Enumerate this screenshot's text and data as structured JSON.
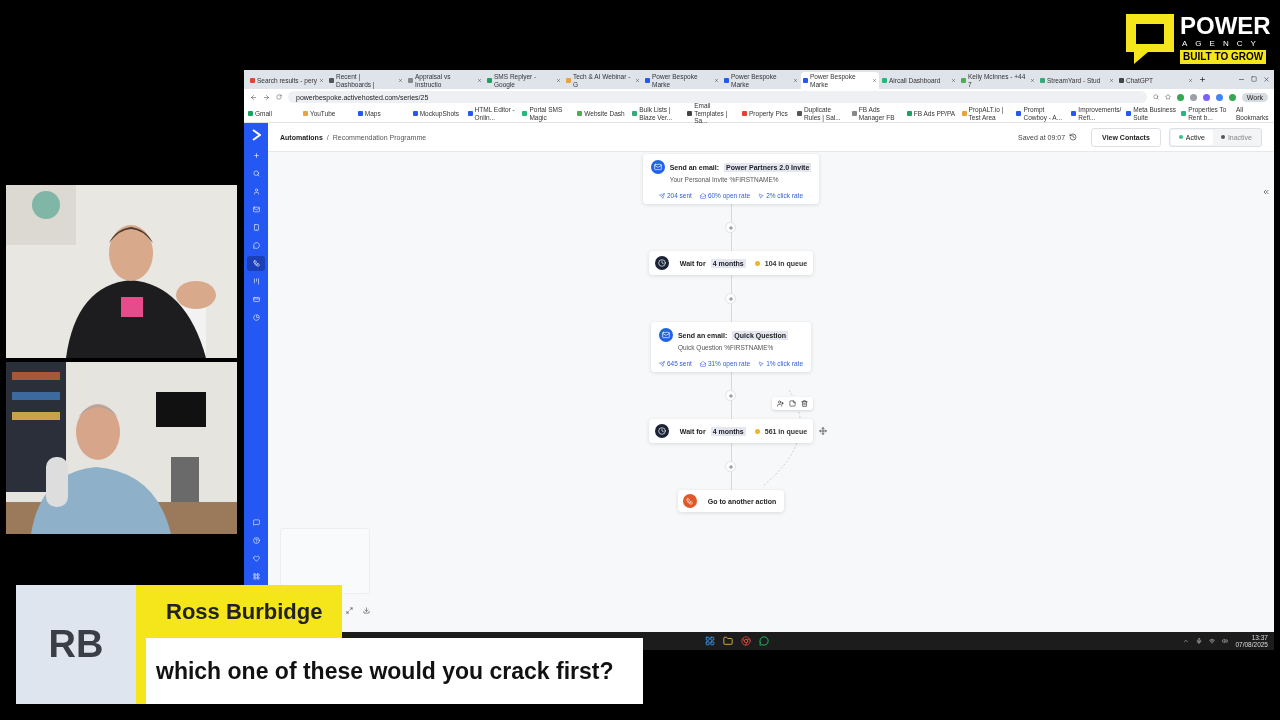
{
  "logo": {
    "word": "POWER",
    "sub": "AGENCY",
    "tagline": "BUILT TO GROW"
  },
  "browser": {
    "tabs": [
      {
        "title": "Search results - pery",
        "selected": false
      },
      {
        "title": "Recent | Dashboards |",
        "selected": false
      },
      {
        "title": "Appraisal vs Instructio",
        "selected": false
      },
      {
        "title": "SMS Replyer - Google",
        "selected": false
      },
      {
        "title": "Tech & AI Webinar - G",
        "selected": false
      },
      {
        "title": "Power Bespoke Marke",
        "selected": false
      },
      {
        "title": "Power Bespoke Marke",
        "selected": false
      },
      {
        "title": "Power Bespoke Marke",
        "selected": true
      },
      {
        "title": "Aircall Dashboard",
        "selected": false
      },
      {
        "title": "Kelly McInnes - +44 7",
        "selected": false
      },
      {
        "title": "StreamYard - Stud",
        "selected": false
      },
      {
        "title": "ChatGPT",
        "selected": false
      }
    ],
    "address": "powerbespoke.activehosted.com/series/25",
    "profile": "Work",
    "bookmarks": [
      "Gmail",
      "YouTube",
      "Maps",
      "MockupShots",
      "HTML Editor - Onlin...",
      "Portal SMS Magic",
      "Website Dash",
      "Bulk Lists | Blaze Ver...",
      "Email Templates | Sa...",
      "Property Pics",
      "Duplicate Rules | Sal...",
      "FB Ads Manager FB",
      "FB Ads PP/PA",
      "PropALT.io | Test Area",
      "Prompt Cowboy - A...",
      "Improvements/Refi...",
      "Meta Business Suite",
      "Properties To Rent b..."
    ],
    "all_bookmarks": "All Bookmarks"
  },
  "app": {
    "nav_items": [
      {
        "selected": false
      },
      {
        "selected": false
      },
      {
        "selected": false
      },
      {
        "selected": false
      },
      {
        "selected": false
      },
      {
        "selected": false
      },
      {
        "selected": true
      },
      {
        "selected": false
      },
      {
        "selected": false
      },
      {
        "selected": false
      }
    ],
    "breadcrumb": [
      "Automations",
      "/",
      "Recommendation Programme"
    ],
    "saved": "Saved at 09:07",
    "view_contacts": "View Contacts",
    "status": [
      {
        "label": "Active",
        "selected": true
      },
      {
        "label": "Inactive",
        "selected": false
      }
    ],
    "steps": [
      {
        "kind": "email",
        "label": "Send an email:",
        "name": "Power Partners 2.0 Invite",
        "subject": "Your Personal Invite %FIRSTNAME%",
        "stats": [
          "204 sent",
          "60% open rate",
          "2% click rate"
        ]
      },
      {
        "kind": "wait",
        "label": "Wait for",
        "duration": "4 months",
        "queue": "104 in queue",
        "toolbar": false
      },
      {
        "kind": "email",
        "label": "Send an email:",
        "name": "Quick Question",
        "subject": "Quick Question %FIRSTNAME%",
        "stats": [
          "645 sent",
          "31% open rate",
          "1% click rate"
        ]
      },
      {
        "kind": "wait",
        "label": "Wait for",
        "duration": "4 months",
        "queue": "561 in queue",
        "toolbar": true
      },
      {
        "kind": "goto",
        "label": "Go to another action"
      }
    ]
  },
  "taskbar": {
    "time": "13:37",
    "date": "07/08/2025"
  },
  "lower_third": {
    "initials": "RB",
    "name": "Ross Burbidge",
    "caption": "which one of these would you crack first?"
  }
}
